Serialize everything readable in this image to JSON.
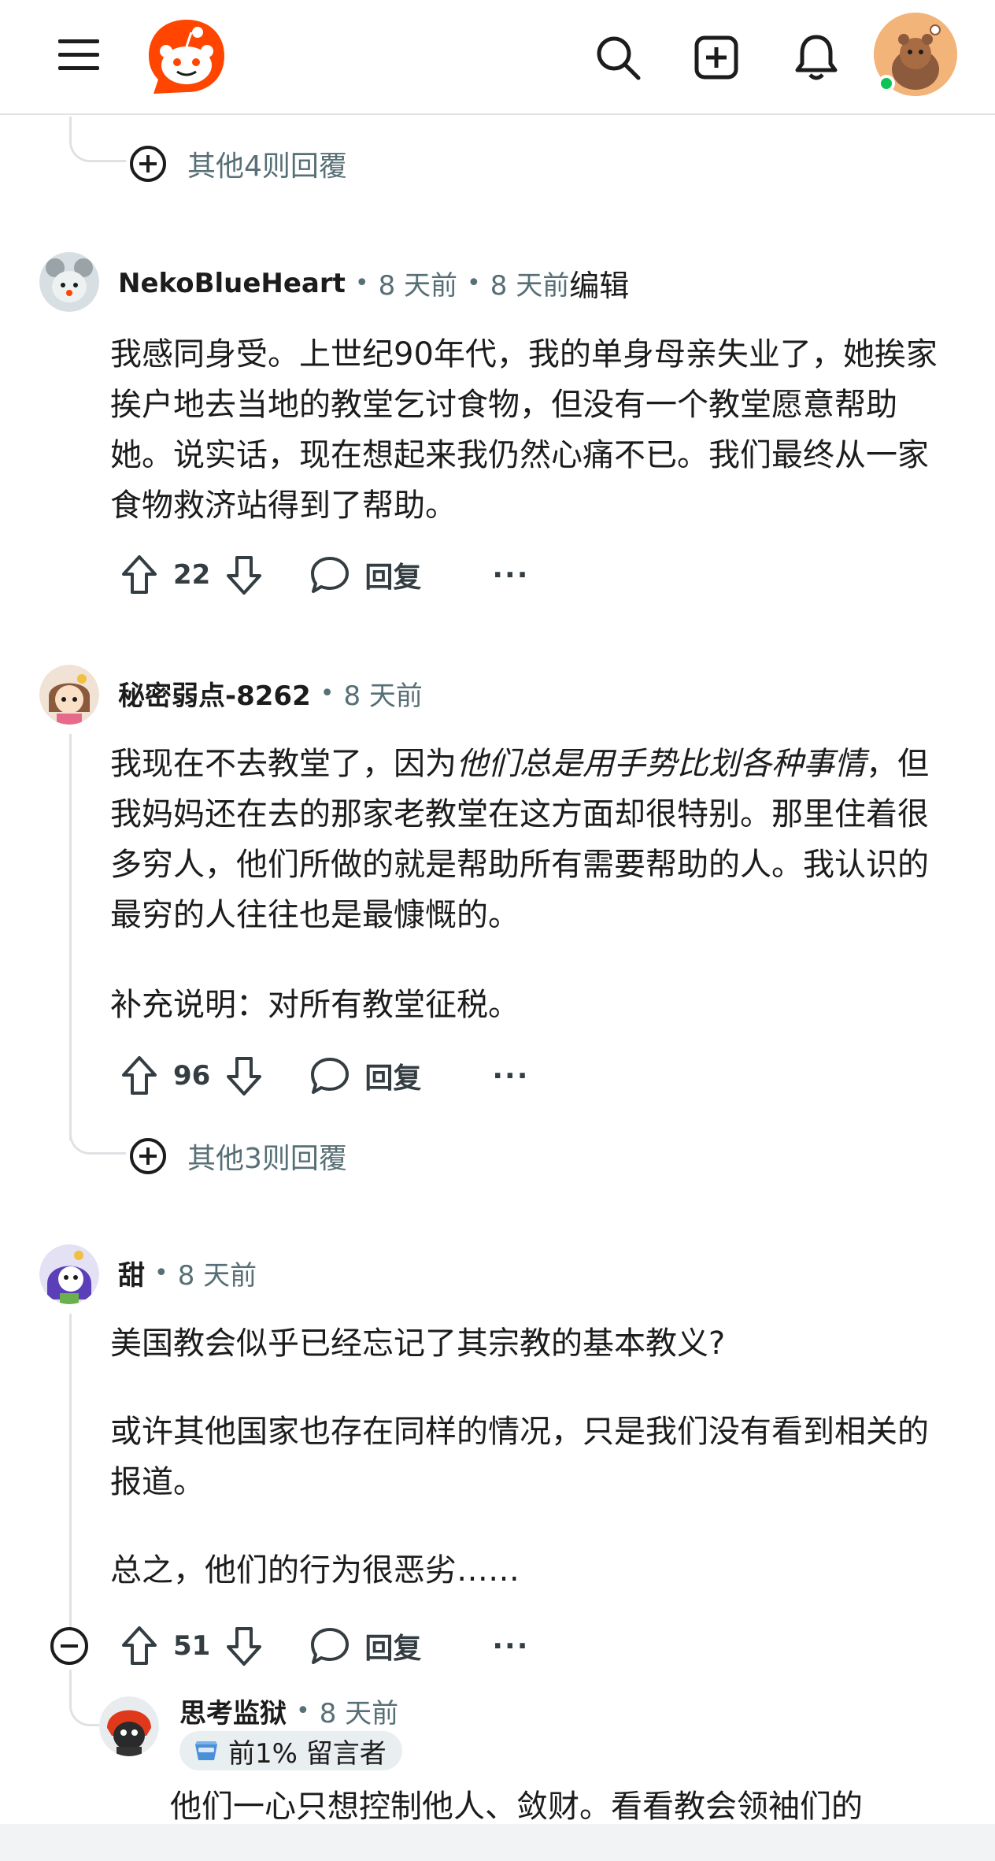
{
  "header": {
    "menu_icon": "hamburger-menu-icon",
    "logo_icon": "reddit-logo-icon",
    "search_icon": "search-icon",
    "create_icon": "create-post-icon",
    "notification_icon": "bell-icon",
    "avatar_icon": "user-avatar-icon",
    "online_color": "#0ec256"
  },
  "more_replies_1": {
    "label": "其他4则回覆"
  },
  "comments": [
    {
      "author": "NekoBlueHeart",
      "time": "8 天前",
      "edited_time": "8 天前",
      "edited_label": "编辑",
      "body": [
        "我感同身受。上世纪90年代，我的单身母亲失业了，她挨家挨户地去当地的教堂乞讨食物，但没有一个教堂愿意帮助她。说实话，现在想起来我仍然心痛不已。我们最终从一家食物救济站得到了帮助。"
      ],
      "score": "22",
      "reply_label": "回复",
      "more_label": "···"
    },
    {
      "author": "秘密弱点-8262",
      "time": "8 天前",
      "body_prefix": "我现在不去教堂了，因为",
      "body_italic": "他们总是用手势比划各种事情",
      "body_suffix": "，但我妈妈还在去的那家老教堂在这方面却很特别。那里住着很多穷人，他们所做的就是帮助所有需要帮助的人。我认识的最穷的人往往也是最慷慨的。",
      "body_p2": "补充说明：对所有教堂征税。",
      "score": "96",
      "reply_label": "回复",
      "more_label": "···"
    },
    {
      "author": "甜",
      "time": "8 天前",
      "body_p1": "美国教会似乎已经忘记了其宗教的基本教义?",
      "body_p2": "或许其他国家也存在同样的情况，只是我们没有看到相关的报道。",
      "body_p3": "总之，他们的行为很恶劣……",
      "score": "51",
      "reply_label": "回复",
      "more_label": "···"
    },
    {
      "author": "思考监狱",
      "time": "8 天前",
      "flair": "前1% 留言者",
      "body": "他们一心只想控制他人、敛财。看看教会领袖们的"
    }
  ],
  "more_replies_2": {
    "label": "其他3则回覆"
  },
  "colors": {
    "accent": "#ff4500",
    "meta": "#576f76",
    "thread_line": "#dfe2e5"
  }
}
